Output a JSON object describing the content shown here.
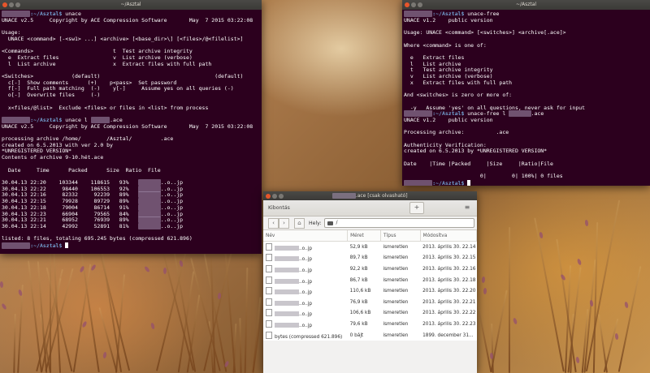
{
  "terminal_left": {
    "title": "~/Asztal",
    "prompt_user": "",
    "prompt_path": ":~/Asztal$",
    "lines": [
      "UNACE v2.5     Copyright by ACE Compression Software       May  7 2015 03:22:08",
      "",
      "Usage:",
      "  UNACE <command> [-<sw1> ...] <archive> [<base_dir>\\] [<files>/@<filelist>]",
      "",
      "<Commands>                         t  Test archive integrity",
      "  e  Extract files                 v  List archive (verbose)",
      "  l  List archive                  x  Extract files with full path",
      "",
      "<Switches>            (default)                                    (default)",
      "  c[-]  Show comments      (+)    p<pass>  Set password",
      "  f[-]  Full path matching  (-)    y[-]     Assume yes on all queries (-)",
      "  o[-]  Overwrite files     (-)",
      "",
      "  x<files/@list>  Exclude <files> or files in <list> from process",
      ""
    ],
    "cmd1": "unace",
    "cmd2": "unace l",
    "cmd2_arg": ".ace",
    "lines2": [
      "UNACE v2.5     Copyright by ACE Compression Software       May  7 2015 03:22:08",
      "",
      "processing archive /home/        /Asztal/         .ace",
      "created on 6.5.2013 with ver 2.0 by",
      "*UNREGISTERED VERSION*",
      "Contents of archive 9-10.hét.ace",
      "",
      "  Date     Time      Packed      Size  Ratio  File",
      ""
    ],
    "rows": [
      [
        "30.04.13",
        "22:20",
        "103344",
        "118615",
        "93%",
        "..o..jp"
      ],
      [
        "30.04.13",
        "22:22",
        "98440",
        "106553",
        "92%",
        "..o..jp"
      ],
      [
        "30.04.13",
        "22:16",
        "82332",
        "92239",
        "89%",
        "..o..jp"
      ],
      [
        "30.04.13",
        "22:15",
        "79928",
        "89729",
        "89%",
        "..o..jp"
      ],
      [
        "30.04.13",
        "22:18",
        "79004",
        "86714",
        "91%",
        "..o..jp"
      ],
      [
        "30.04.13",
        "22:23",
        "66904",
        "79565",
        "84%",
        "..o..jp"
      ],
      [
        "30.04.13",
        "22:21",
        "68952",
        "76939",
        "89%",
        "..o..jp"
      ],
      [
        "30.04.13",
        "22:14",
        "42992",
        "52891",
        "81%",
        "..o..jp"
      ]
    ],
    "summary": "listed: 8 files, totaling 695.245 bytes (compressed 621.896)"
  },
  "terminal_right": {
    "title": "~/Asztal",
    "prompt_path": ":~/Asztal$",
    "cmd1": "unace-free",
    "lines1": [
      "UNACE v1.2    public version",
      "",
      "Usage: UNACE <command> [<switches>] <archive[.ace]>",
      "",
      "Where <command> is one of:",
      "",
      "  e   Extract files",
      "  l   List archive",
      "  t   Test archive integrity",
      "  v   List archive (verbose)",
      "  x   Extract files with full path",
      "",
      "And <switches> is zero or more of:",
      "",
      "  -y   Assume 'yes' on all questions, never ask for input"
    ],
    "cmd2": "unace-free l",
    "cmd2_arg": ".ace",
    "lines2": [
      "UNACE v1.2    public version",
      "",
      "Processing archive:          .ace",
      "",
      "Authenticity Verification:",
      "created on 6.5.2013 by *UNREGISTERED VERSION*",
      "",
      "Date    |Time |Packed     |Size     |Ratio|File",
      "",
      "                        0|        0| 100%| 0 files"
    ]
  },
  "file_roller": {
    "title": ".ace [csak olvasható]",
    "extract_label": "Kibontás",
    "add_icon": "+",
    "menu_icon": "≡",
    "location_label": "Hely:",
    "location_value": "/",
    "columns": [
      "Név",
      "Méret",
      "Típus",
      "Módosítva"
    ],
    "files": [
      {
        "name": "..o..jp",
        "size": "52,9 kB",
        "type": "ismeretlen",
        "modified": "2013. április 30. 22.14"
      },
      {
        "name": "..o..jp",
        "size": "89,7 kB",
        "type": "ismeretlen",
        "modified": "2013. április 30. 22.15"
      },
      {
        "name": "..o..jp",
        "size": "92,2 kB",
        "type": "ismeretlen",
        "modified": "2013. április 30. 22.16"
      },
      {
        "name": "..o..jp",
        "size": "86,7 kB",
        "type": "ismeretlen",
        "modified": "2013. április 30. 22.18"
      },
      {
        "name": "..o..jp",
        "size": "110,6 kB",
        "type": "ismeretlen",
        "modified": "2013. április 30. 22.20"
      },
      {
        "name": "..o..jp",
        "size": "76,9 kB",
        "type": "ismeretlen",
        "modified": "2013. április 30. 22.21"
      },
      {
        "name": "..o..jp",
        "size": "106,6 kB",
        "type": "ismeretlen",
        "modified": "2013. április 30. 22.22"
      },
      {
        "name": "..o..jp",
        "size": "79,6 kB",
        "type": "ismeretlen",
        "modified": "2013. április 30. 22.23"
      }
    ],
    "bytes_row": {
      "name": "bytes (compressed 621.896)",
      "size": "0 bájt",
      "type": "ismeretlen",
      "modified": "1899. december 31..."
    }
  }
}
